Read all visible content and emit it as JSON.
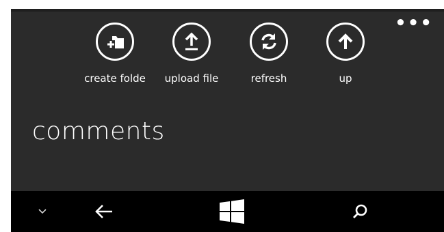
{
  "appbar": {
    "buttons": [
      {
        "label": "create folde",
        "icon": "create-folder-icon"
      },
      {
        "label": "upload file",
        "icon": "upload-icon"
      },
      {
        "label": "refresh",
        "icon": "refresh-icon"
      },
      {
        "label": "up",
        "icon": "arrow-up-icon"
      }
    ],
    "more_label": "•••"
  },
  "page": {
    "title": "comments"
  },
  "navbar": {
    "icons": [
      "chevron-down-icon",
      "back-arrow-icon",
      "windows-start-icon",
      "search-icon"
    ]
  },
  "colors": {
    "background": "#2b2b2b",
    "navbar": "#000000",
    "foreground": "#ffffff"
  }
}
